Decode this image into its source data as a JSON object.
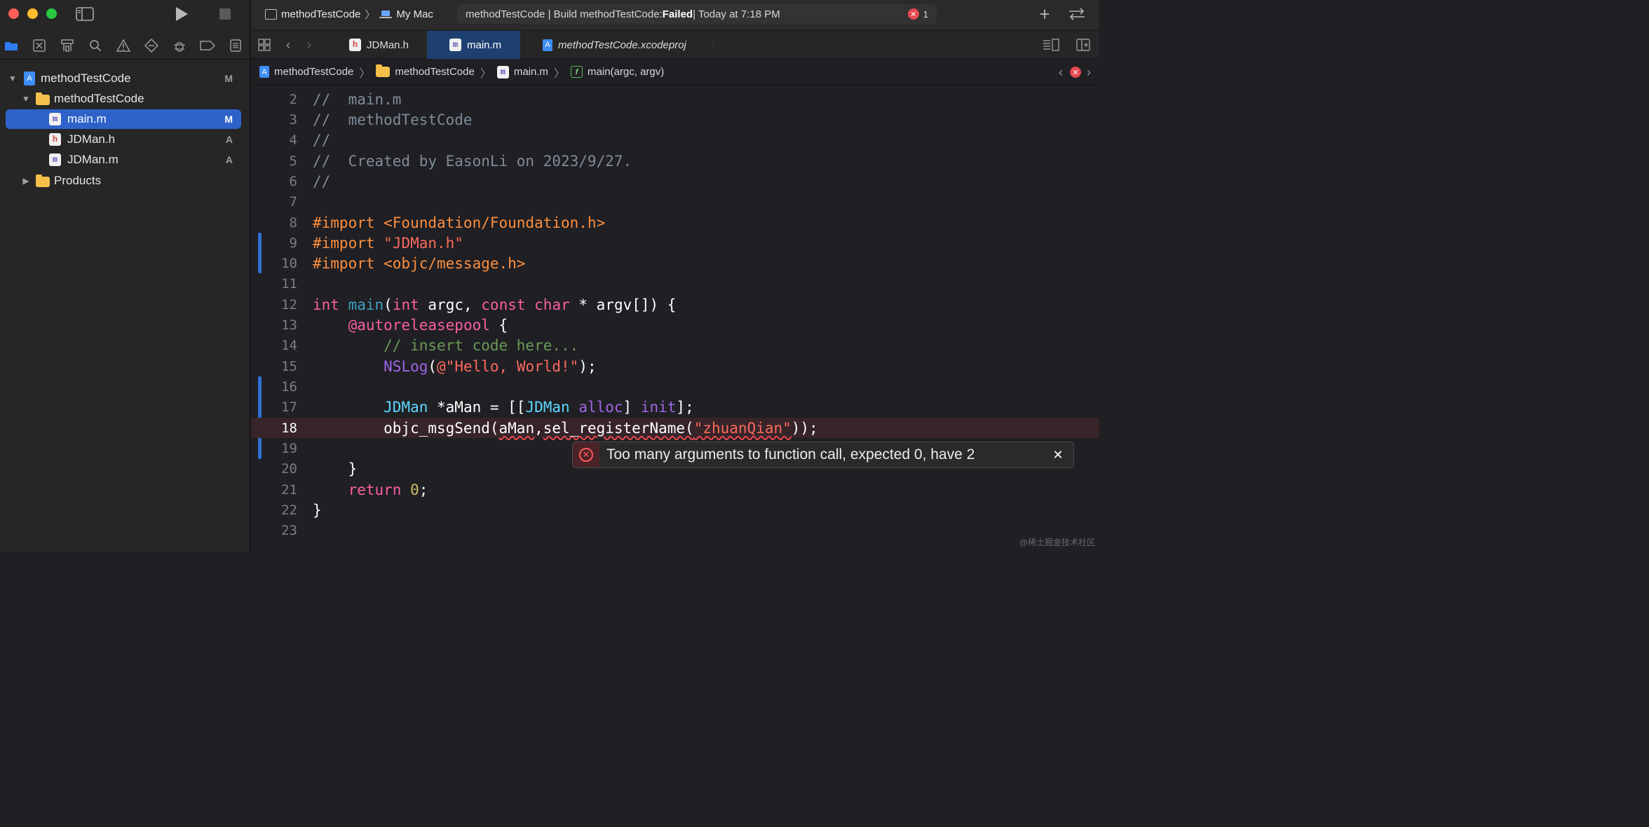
{
  "sidebar": {
    "tree": [
      {
        "label": "methodTestCode",
        "badge": "M"
      },
      {
        "label": "methodTestCode",
        "badge": ""
      },
      {
        "label": "main.m",
        "badge": "M"
      },
      {
        "label": "JDMan.h",
        "badge": "A"
      },
      {
        "label": "JDMan.m",
        "badge": "A"
      },
      {
        "label": "Products",
        "badge": ""
      }
    ]
  },
  "toolbar": {
    "scheme": "methodTestCode",
    "destination": "My Mac",
    "activity_prefix": "methodTestCode | Build methodTestCode: ",
    "activity_status": "Failed",
    "activity_suffix": " | Today at 7:18 PM",
    "error_count": "1"
  },
  "tabs": [
    {
      "label": "JDMan.h",
      "icon": "h"
    },
    {
      "label": "main.m",
      "icon": "m"
    },
    {
      "label": "methodTestCode.xcodeproj",
      "icon": "proj"
    }
  ],
  "jumpbar": {
    "project": "methodTestCode",
    "group": "methodTestCode",
    "file": "main.m",
    "symbol": "main(argc, argv)"
  },
  "editor": {
    "line_numbers": [
      "2",
      "3",
      "4",
      "5",
      "6",
      "7",
      "8",
      "9",
      "10",
      "11",
      "12",
      "13",
      "14",
      "15",
      "16",
      "17",
      "18",
      "19",
      "20",
      "21",
      "22",
      "23"
    ],
    "error_message": "Too many arguments to function call, expected 0, have 2"
  },
  "watermark": "@稀土掘金技术社区",
  "colors": {
    "selection": "#2e62c9",
    "active_tab": "#1e4070",
    "error": "#e5484d",
    "change_bar": "#2f6fd4"
  }
}
